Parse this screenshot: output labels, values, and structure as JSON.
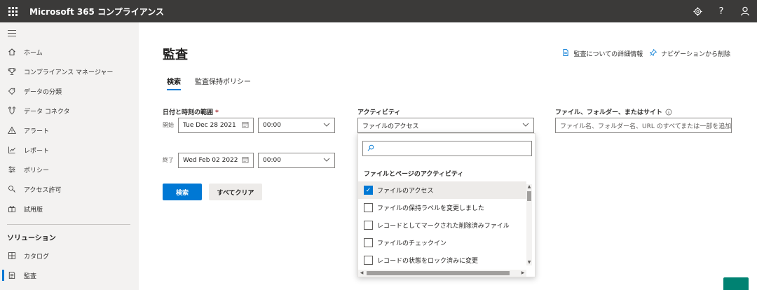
{
  "header": {
    "app_title": "Microsoft 365 コンプライアンス",
    "icons": [
      "waffle-icon",
      "gear-icon",
      "help-icon",
      "user-icon"
    ],
    "help_glyph": "?"
  },
  "sidebar": {
    "items": [
      {
        "label": "ホーム",
        "icon": "home-icon"
      },
      {
        "label": "コンプライアンス マネージャー",
        "icon": "trophy-icon"
      },
      {
        "label": "データの分類",
        "icon": "tag-icon"
      },
      {
        "label": "データ コネクタ",
        "icon": "connector-icon"
      },
      {
        "label": "アラート",
        "icon": "alert-icon"
      },
      {
        "label": "レポート",
        "icon": "chart-icon"
      },
      {
        "label": "ポリシー",
        "icon": "policy-icon"
      },
      {
        "label": "アクセス許可",
        "icon": "key-icon"
      },
      {
        "label": "試用版",
        "icon": "trial-icon"
      }
    ],
    "section_title": "ソリューション",
    "solutions": [
      {
        "label": "カタログ",
        "icon": "catalog-icon"
      },
      {
        "label": "監査",
        "icon": "audit-icon",
        "active": true
      }
    ]
  },
  "main": {
    "title": "監査",
    "links": {
      "learn_more": "監査についての詳細情報",
      "remove_nav": "ナビゲーションから削除"
    },
    "tabs": [
      {
        "label": "検索",
        "active": true
      },
      {
        "label": "監査保持ポリシー",
        "active": false
      }
    ],
    "date_range": {
      "label": "日付と時刻の範囲",
      "required_mark": "*",
      "start_label": "開始",
      "start_date": "Tue Dec 28 2021",
      "start_time": "00:00",
      "end_label": "終了",
      "end_date": "Wed Feb 02 2022",
      "end_time": "00:00"
    },
    "activities": {
      "label": "アクティビティ",
      "selected": "ファイルのアクセス",
      "group_title": "ファイルとページのアクティビティ",
      "options": [
        {
          "label": "ファイルのアクセス",
          "checked": true
        },
        {
          "label": "ファイルの保持ラベルを変更しました",
          "checked": false
        },
        {
          "label": "レコードとしてマークされた削除済みファイル",
          "checked": false
        },
        {
          "label": "ファイルのチェックイン",
          "checked": false
        },
        {
          "label": "レコードの状態をロック済みに変更",
          "checked": false
        }
      ]
    },
    "file_filter": {
      "label": "ファイル、フォルダー、またはサイト",
      "placeholder": "ファイル名、フォルダー名、URL のすべてまたは一部を追加"
    },
    "buttons": {
      "search": "検索",
      "clear_all": "すべてクリア"
    }
  },
  "colors": {
    "accent": "#0078d4",
    "topbar": "#3b3a39",
    "sidebar": "#f3f2f1",
    "fab": "#008272"
  }
}
